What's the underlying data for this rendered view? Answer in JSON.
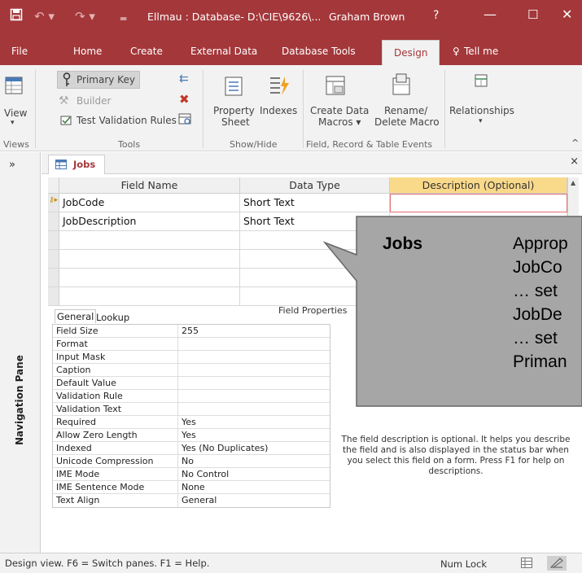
{
  "window": {
    "title": "Ellmau : Database- D:\\CIE\\9626\\...",
    "user": "Graham Brown",
    "help": "?",
    "minimize": "—",
    "restore": "☐",
    "close": "✕"
  },
  "tabs": {
    "file": "File",
    "home": "Home",
    "create": "Create",
    "external": "External Data",
    "dbtools": "Database Tools",
    "design": "Design",
    "tellme": "Tell me"
  },
  "ribbon": {
    "view": "View",
    "primary_key": "Primary Key",
    "builder": "Builder",
    "test_validation": "Test Validation Rules",
    "property_sheet_1": "Property",
    "property_sheet_2": "Sheet",
    "indexes": "Indexes",
    "create_data_1": "Create Data",
    "create_data_2": "Macros ▾",
    "rename_1": "Rename/",
    "rename_2": "Delete Macro",
    "relationships": "Relationships",
    "groups": {
      "views": "Views",
      "tools": "Tools",
      "showhide": "Show/Hide",
      "events": "Field, Record & Table Events"
    }
  },
  "nav": {
    "label": "Navigation Pane",
    "chevron": "»"
  },
  "doc_tab": {
    "label": "Jobs",
    "close": "×"
  },
  "grid": {
    "headers": {
      "field_name": "Field Name",
      "data_type": "Data Type",
      "description": "Description (Optional)"
    },
    "rows": [
      {
        "name": "JobCode",
        "type": "Short Text"
      },
      {
        "name": "JobDescription",
        "type": "Short Text"
      }
    ]
  },
  "field_properties": {
    "title": "Field Properties",
    "tabs": {
      "general": "General",
      "lookup": "Lookup"
    },
    "rows": [
      {
        "k": "Field Size",
        "v": "255"
      },
      {
        "k": "Format",
        "v": ""
      },
      {
        "k": "Input Mask",
        "v": ""
      },
      {
        "k": "Caption",
        "v": ""
      },
      {
        "k": "Default Value",
        "v": ""
      },
      {
        "k": "Validation Rule",
        "v": ""
      },
      {
        "k": "Validation Text",
        "v": ""
      },
      {
        "k": "Required",
        "v": "Yes"
      },
      {
        "k": "Allow Zero Length",
        "v": "Yes"
      },
      {
        "k": "Indexed",
        "v": "Yes (No Duplicates)"
      },
      {
        "k": "Unicode Compression",
        "v": "No"
      },
      {
        "k": "IME Mode",
        "v": "No Control"
      },
      {
        "k": "IME Sentence Mode",
        "v": "None"
      },
      {
        "k": "Text Align",
        "v": "General"
      }
    ],
    "help": "The field description is optional. It helps you describe the field and is also displayed in the status bar when you select this field on a form. Press F1 for help on descriptions."
  },
  "callout": {
    "key": "Jobs",
    "lines": [
      "Approp",
      "JobCo",
      "… set",
      "JobDe",
      "… set",
      "Priman"
    ]
  },
  "status": {
    "left": "Design view.  F6 = Switch panes.  F1 = Help.",
    "num_lock": "Num Lock"
  },
  "colors": {
    "accent": "#a4373a",
    "callout_fill": "#a6a6a6"
  }
}
